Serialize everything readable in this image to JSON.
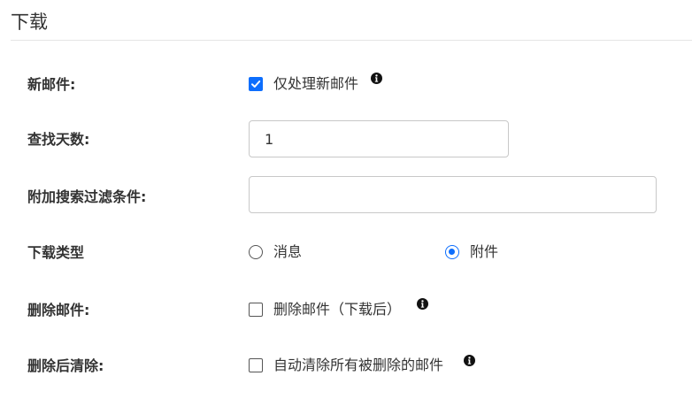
{
  "section": {
    "title": "下载"
  },
  "fields": {
    "new_mail": {
      "label": "新邮件:",
      "checkbox_label": "仅处理新邮件",
      "checked": true,
      "info_icon": "info-icon"
    },
    "search_days": {
      "label": "查找天数:",
      "value": "1"
    },
    "extra_filter": {
      "label": "附加搜索过滤条件:",
      "value": ""
    },
    "download_type": {
      "label": "下载类型",
      "options": [
        "消息",
        "附件"
      ],
      "selected": "附件"
    },
    "delete_mail": {
      "label": "删除邮件:",
      "checkbox_label": "删除邮件（下载后）",
      "checked": false,
      "info_icon": "info-icon"
    },
    "purge_after_delete": {
      "label": "删除后清除:",
      "checkbox_label": "自动清除所有被删除的邮件",
      "checked": false,
      "info_icon": "info-icon"
    }
  },
  "colors": {
    "accent": "#0d6efd",
    "text": "#333333",
    "border": "#c8c8c8"
  }
}
